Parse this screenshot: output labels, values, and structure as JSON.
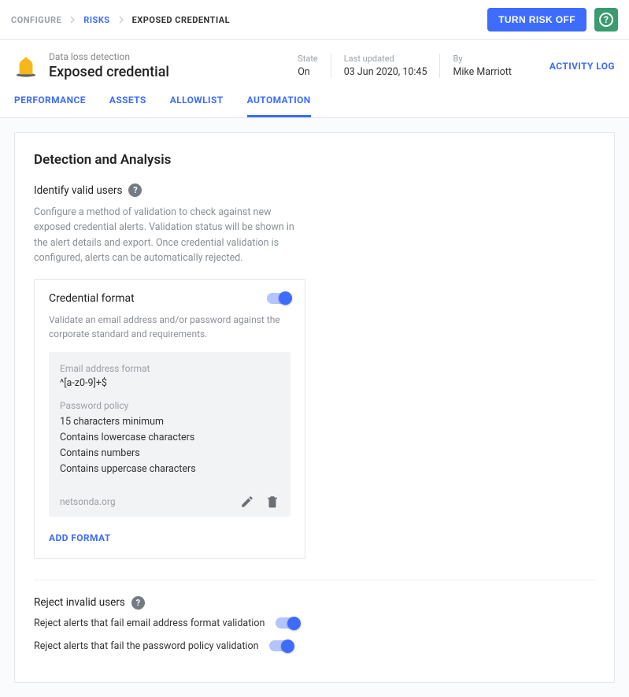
{
  "breadcrumb": {
    "configure": "CONFIGURE",
    "risks": "RISKS",
    "current": "EXPOSED CREDENTIAL"
  },
  "topbar": {
    "turn_off": "TURN RISK OFF"
  },
  "header": {
    "subtitle": "Data loss detection",
    "title": "Exposed credential",
    "state_label": "State",
    "state_value": "On",
    "updated_label": "Last updated",
    "updated_value": "03 Jun 2020, 10:45",
    "by_label": "By",
    "by_value": "Mike Marriott",
    "activity": "ACTIVITY LOG"
  },
  "tabs": {
    "performance": "PERFORMANCE",
    "assets": "ASSETS",
    "allowlist": "ALLOWLIST",
    "automation": "AUTOMATION"
  },
  "detection": {
    "title": "Detection and Analysis",
    "identify_label": "Identify valid users",
    "identify_desc": "Configure a method of validation to check against new exposed credential alerts. Validation status will be shown in the alert details and export. Once credential validation is configured, alerts can be automatically rejected.",
    "card_title": "Credential format",
    "card_desc": "Validate an email address and/or password against the corporate standard and requirements.",
    "email_label": "Email address format",
    "email_value": "^[a-z0-9]+$",
    "policy_label": "Password policy",
    "policy_items": [
      "15 characters minimum",
      "Contains lowercase characters",
      "Contains numbers",
      "Contains uppercase characters"
    ],
    "domain": "netsonda.org",
    "add": "ADD FORMAT"
  },
  "reject": {
    "label": "Reject invalid users",
    "row1": "Reject alerts that fail email address format validation",
    "row2": "Reject alerts that fail the password policy validation"
  }
}
